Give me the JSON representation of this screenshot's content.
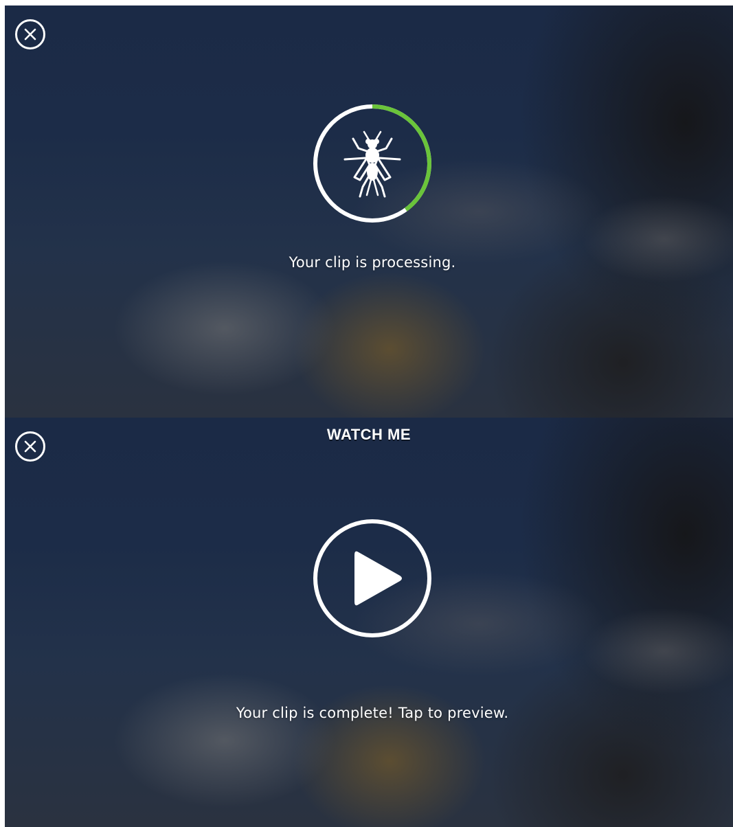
{
  "screens": {
    "processing": {
      "message": "Your clip is processing.",
      "progress_fraction": 0.4,
      "progress_color": "#6ac43a",
      "track_color": "#ffffff",
      "center_icon": "fly-icon",
      "close_icon": "close-icon"
    },
    "complete": {
      "title": "WATCH ME",
      "message": "Your clip is complete! Tap to preview.",
      "center_icon": "play-icon",
      "close_icon": "close-icon"
    }
  },
  "colors": {
    "background": "#1c2c48",
    "foreground": "#ffffff",
    "accent": "#6ac43a"
  }
}
